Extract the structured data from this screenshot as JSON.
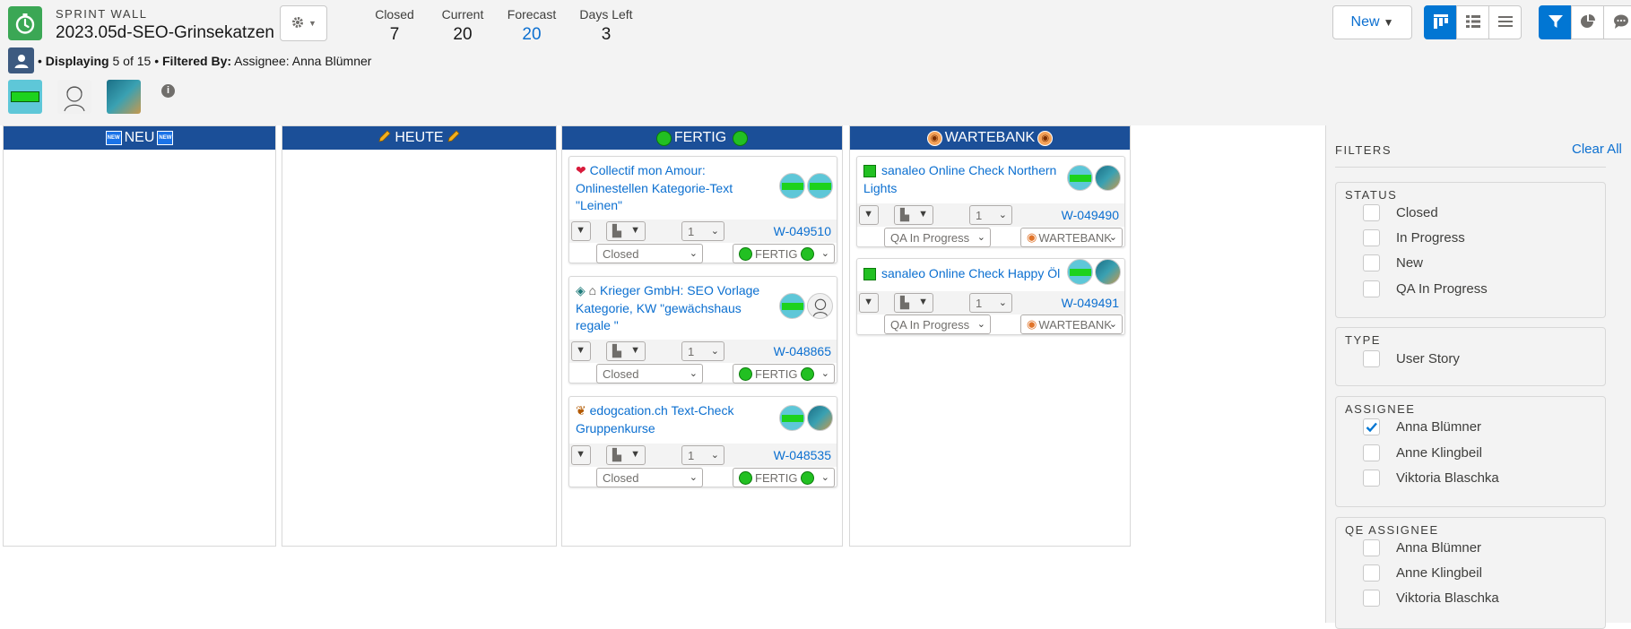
{
  "header": {
    "eyebrow": "SPRINT WALL",
    "title": "2023.05d-SEO-Grinsekatzen",
    "stats": [
      {
        "label": "Closed",
        "value": "7"
      },
      {
        "label": "Current",
        "value": "20"
      },
      {
        "label": "Forecast",
        "value": "20"
      },
      {
        "label": "Days Left",
        "value": "3"
      }
    ],
    "new_label": "New",
    "filter_displaying_label": "Displaying",
    "filter_count": "5 of 15",
    "filter_by_label": "Filtered By:",
    "filter_value": "Assignee: Anna Blümner",
    "info_glyph": "i"
  },
  "columns": [
    {
      "title": "NEU",
      "icon": "new-tag-icon"
    },
    {
      "title": "HEUTE",
      "icon": "pencil-icon"
    },
    {
      "title": "FERTIG",
      "icon": "green-circle-icon"
    },
    {
      "title": "WARTEBANK",
      "icon": "owl-icon"
    }
  ],
  "cards": {
    "fertig": [
      {
        "title": "Collectif mon Amour: Onlinestellen Kategorie-Text \"Leinen\"",
        "points": "1",
        "id": "W-049510",
        "status": "Closed",
        "column": "FERTIG",
        "icon": "heart-icon"
      },
      {
        "title": "Krieger GmbH: SEO Vorlage Kategorie, KW \"gewächshaus regale \"",
        "points": "1",
        "id": "W-048865",
        "status": "Closed",
        "column": "FERTIG",
        "icon": "house-icon"
      },
      {
        "title": "edogcation.ch Text-Check Gruppenkurse",
        "points": "1",
        "id": "W-048535",
        "status": "Closed",
        "column": "FERTIG",
        "icon": "paw-icon"
      }
    ],
    "wartebank": [
      {
        "title": "sanaleo Online Check Northern Lights",
        "points": "1",
        "id": "W-049490",
        "status": "QA In Progress",
        "column": "WARTEBANK",
        "icon": "green-square-icon"
      },
      {
        "title": "sanaleo Online Check Happy Öl",
        "points": "1",
        "id": "W-049491",
        "status": "QA In Progress",
        "column": "WARTEBANK",
        "icon": "green-square-icon"
      }
    ]
  },
  "filters": {
    "title": "FILTERS",
    "clear_all": "Clear All",
    "groups": [
      {
        "heading": "STATUS",
        "options": [
          {
            "label": "Closed",
            "checked": false
          },
          {
            "label": "In Progress",
            "checked": false
          },
          {
            "label": "New",
            "checked": false
          },
          {
            "label": "QA In Progress",
            "checked": false
          }
        ]
      },
      {
        "heading": "TYPE",
        "options": [
          {
            "label": "User Story",
            "checked": false
          }
        ]
      },
      {
        "heading": "ASSIGNEE",
        "options": [
          {
            "label": "Anna Blümner",
            "checked": true
          },
          {
            "label": "Anne Klingbeil",
            "checked": false
          },
          {
            "label": "Viktoria Blaschka",
            "checked": false
          }
        ]
      },
      {
        "heading": "QE ASSIGNEE",
        "options": [
          {
            "label": "Anna Blümner",
            "checked": false
          },
          {
            "label": "Anne Klingbeil",
            "checked": false
          },
          {
            "label": "Viktoria Blaschka",
            "checked": false
          }
        ]
      }
    ]
  },
  "colors": {
    "brand_blue": "#0176d3",
    "column_header": "#1b4f98",
    "link": "#0b6fd0",
    "app_green": "#3ba755",
    "status_green": "#22c022"
  }
}
